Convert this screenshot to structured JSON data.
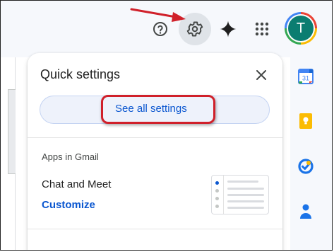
{
  "quick_settings": {
    "title": "Quick settings",
    "see_all_label": "See all settings",
    "apps_section_label": "Apps in Gmail",
    "chat_meet_label": "Chat and Meet",
    "customize_label": "Customize"
  },
  "account": {
    "avatar_letter": "T"
  },
  "icons": [
    "help-icon",
    "gear-icon",
    "gemini-sparkle-icon",
    "apps-grid-icon",
    "close-icon",
    "calendar-icon",
    "keep-icon",
    "tasks-icon",
    "contacts-icon"
  ],
  "calendar_day": "31",
  "colors": {
    "accent": "#0b57d0",
    "annotation": "#d0202a",
    "avatar": "#0b7d71"
  }
}
